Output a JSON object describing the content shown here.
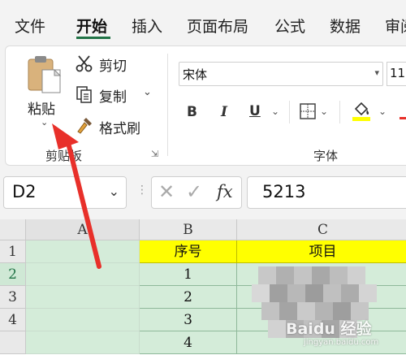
{
  "ribbon_tabs": [
    "文件",
    "开始",
    "插入",
    "页面布局",
    "公式",
    "数据",
    "审阅"
  ],
  "clipboard": {
    "paste_label": "粘贴",
    "cut_label": "剪切",
    "copy_label": "复制",
    "format_painter_label": "格式刷",
    "group_label": "剪贴板"
  },
  "font": {
    "font_name": "宋体",
    "font_size": "11",
    "group_label": "字体",
    "bold": "B",
    "italic": "I",
    "underline": "U"
  },
  "formula_bar": {
    "name_box": "D2",
    "fx_label": "fx",
    "formula": "5213"
  },
  "sheet": {
    "columns": [
      "A",
      "B",
      "C"
    ],
    "rows": [
      "1",
      "2",
      "3",
      "4"
    ],
    "header_b": "序号",
    "header_c": "项目",
    "b_values": [
      "1",
      "2",
      "3",
      "4"
    ]
  },
  "watermark": {
    "text": "Baidu 经验",
    "sub": "jingyan.baidu.com"
  },
  "colors": {
    "accent": "#217346",
    "highlight": "#ffff00",
    "fill": "#d4ecd9",
    "arrow": "#e8302a"
  }
}
